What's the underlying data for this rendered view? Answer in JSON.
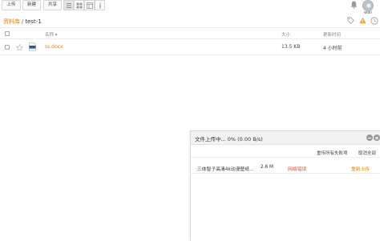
{
  "toolbar": {
    "upload_label": "上传",
    "new_label": "新建",
    "share_label": "共享",
    "views": [
      "list-view-icon",
      "grid-view-icon",
      "column-view-icon",
      "info-icon"
    ]
  },
  "header": {
    "notification_icon": "bell-icon",
    "avatar_label": "wali"
  },
  "breadcrumb": {
    "root": "资料库",
    "separator": "/",
    "current": "test-1"
  },
  "table": {
    "columns": {
      "name": "名称",
      "sort_indicator": "▾",
      "size": "大小",
      "modified": "更新时间"
    },
    "rows": [
      {
        "name": "ss.docx",
        "size": "13.5 KB",
        "modified": "4 小时前",
        "icon": "word-document-icon"
      }
    ]
  },
  "upload_panel": {
    "title": "文件上传中... 0% (0.00 B/s)",
    "retry_all": "重传所有失败项",
    "cancel_all": "取消全部",
    "items": [
      {
        "name": "三体智子高清4k动漫壁纸...",
        "size": "2.6 M",
        "status": "网络错误",
        "action": "重新上传"
      }
    ]
  },
  "colors": {
    "accent": "#eb8205",
    "error": "#e34a1e"
  }
}
